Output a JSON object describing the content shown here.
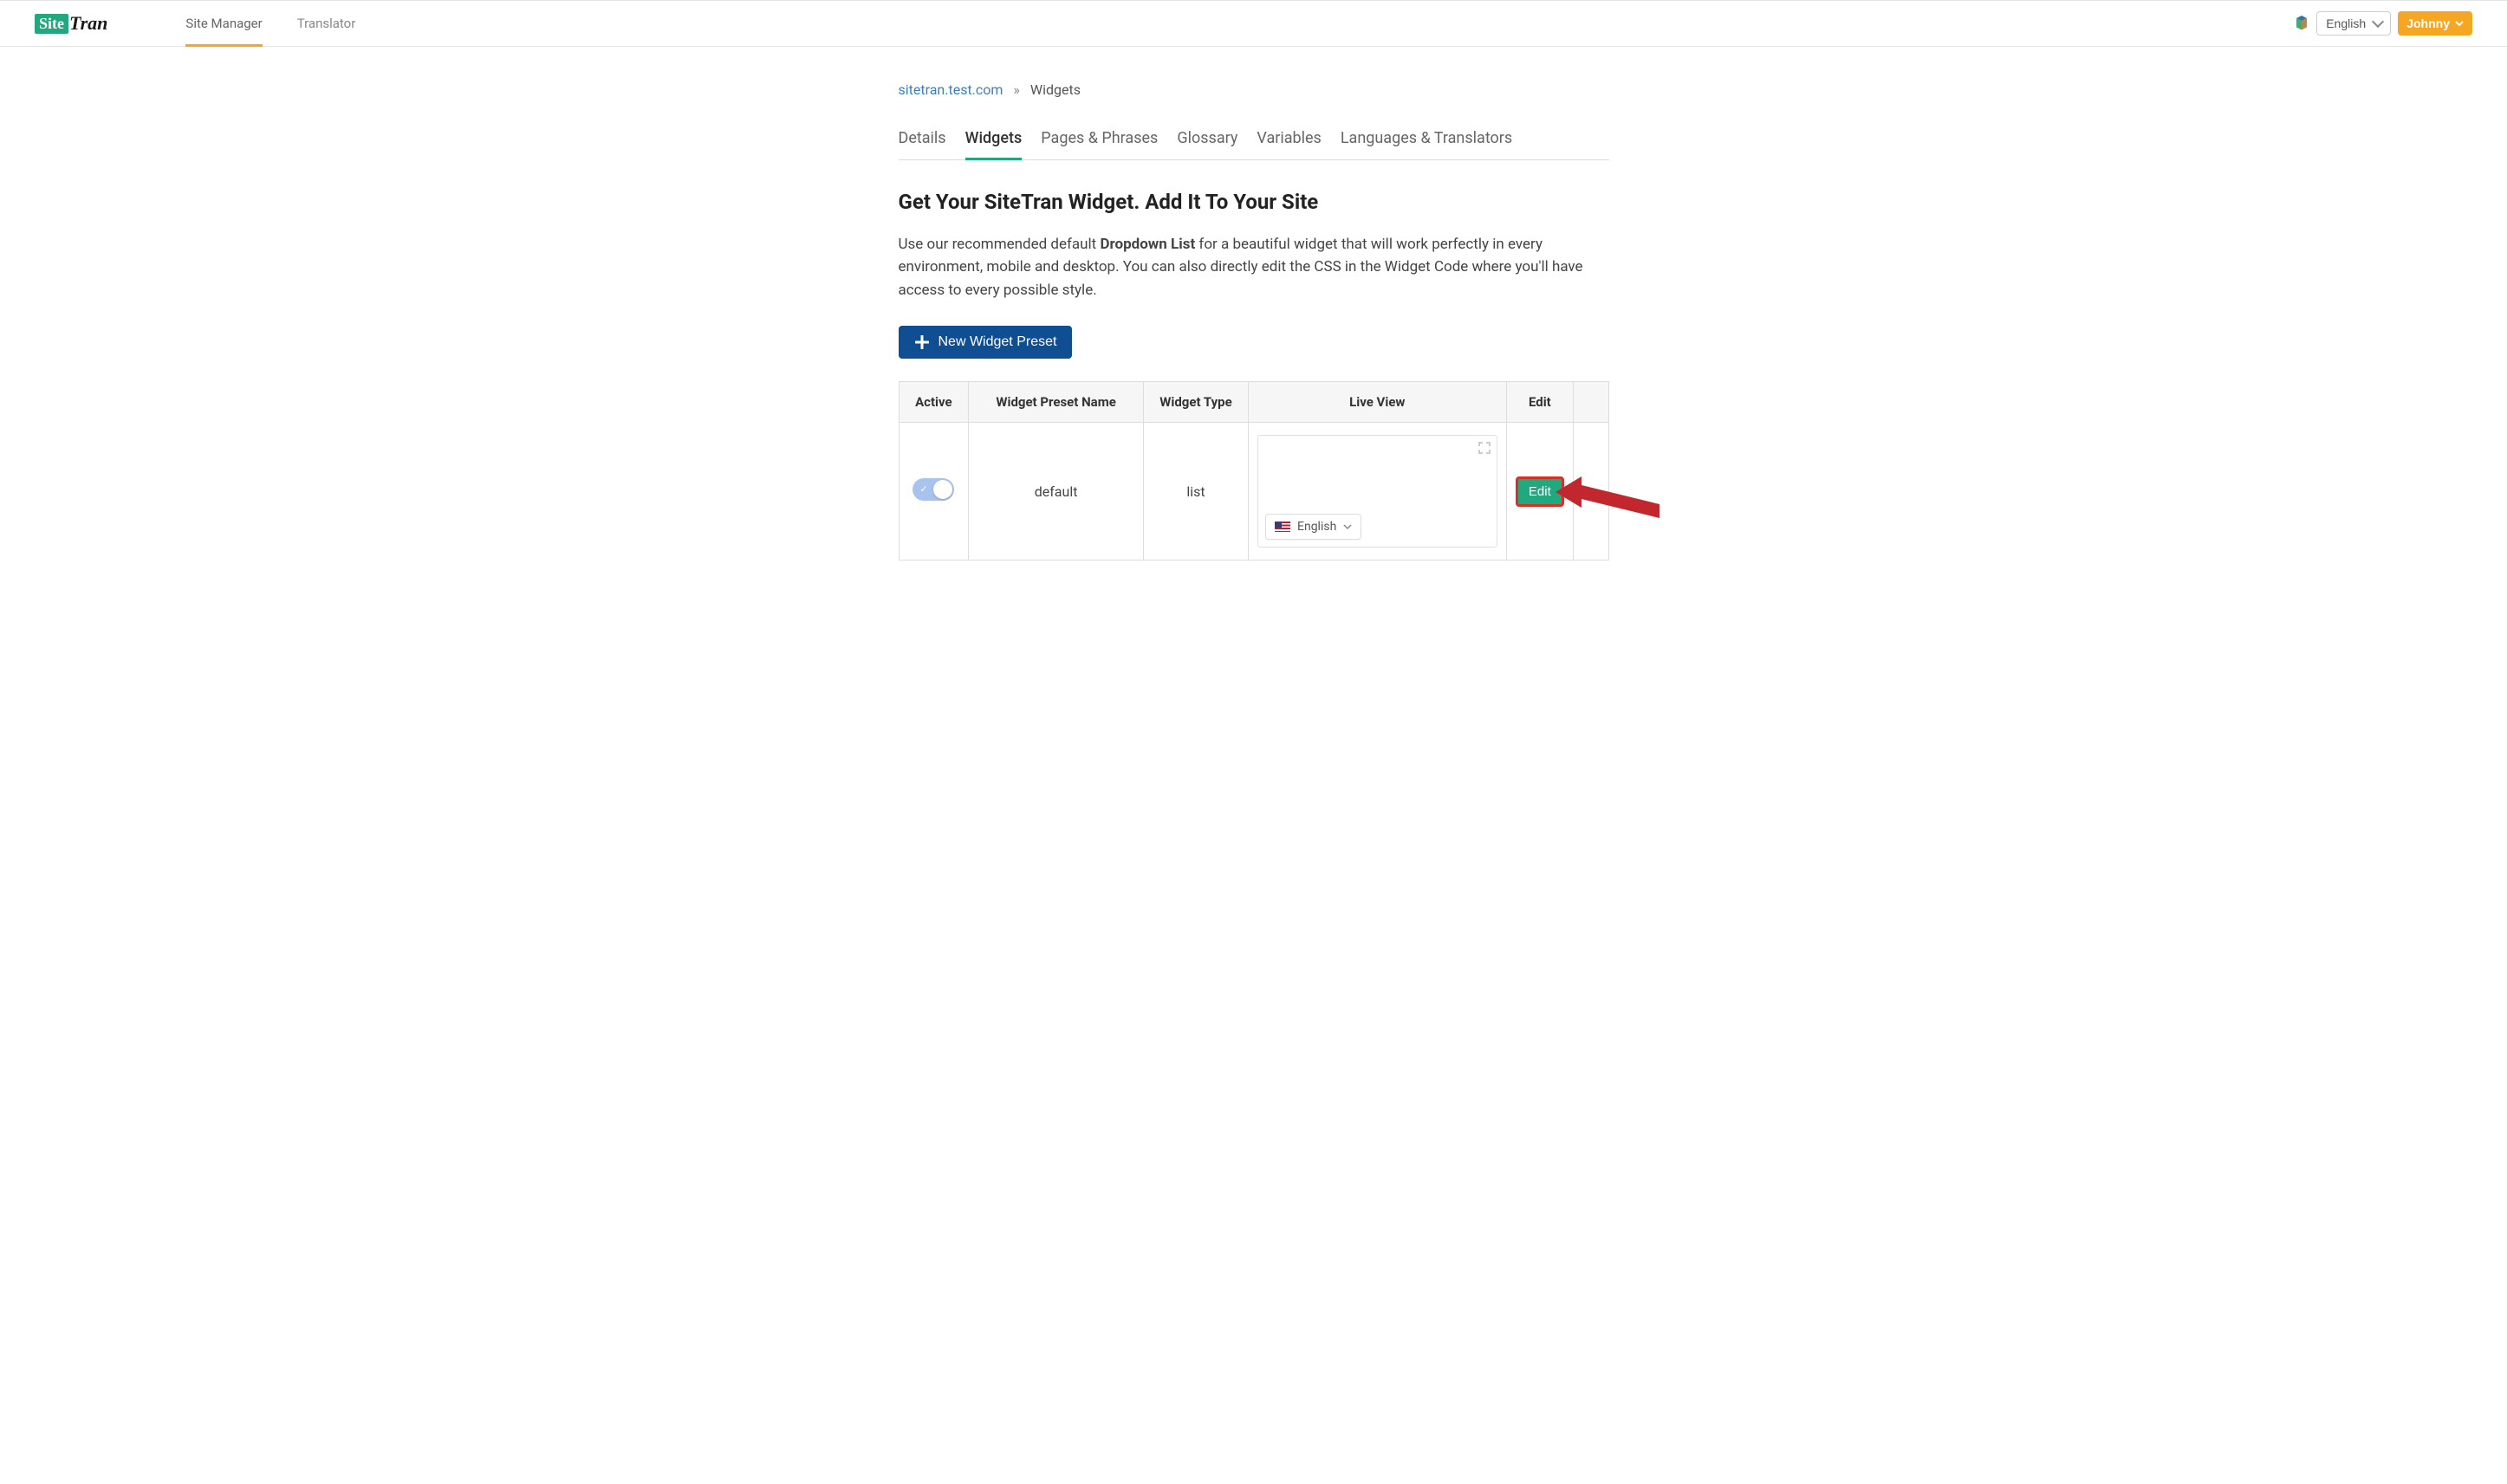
{
  "topnav": {
    "logo_box": "Site",
    "logo_rest": "Tran",
    "links": [
      {
        "label": "Site Manager",
        "active": true
      },
      {
        "label": "Translator",
        "active": false
      }
    ],
    "lang_selected": "English",
    "user_name": "Johnny"
  },
  "breadcrumb": {
    "site": "sitetran.test.com",
    "sep": "»",
    "current": "Widgets"
  },
  "subtabs": [
    {
      "label": "Details",
      "active": false
    },
    {
      "label": "Widgets",
      "active": true
    },
    {
      "label": "Pages & Phrases",
      "active": false
    },
    {
      "label": "Glossary",
      "active": false
    },
    {
      "label": "Variables",
      "active": false
    },
    {
      "label": "Languages & Translators",
      "active": false
    }
  ],
  "heading": "Get Your SiteTran Widget. Add It To Your Site",
  "desc_pre": "Use our recommended default ",
  "desc_bold": "Dropdown List",
  "desc_post": " for a beautiful widget that will work perfectly in every environment, mobile and desktop. You can also directly edit the CSS in the Widget Code where you'll have access to every possible style.",
  "new_preset_label": "New Widget Preset",
  "table": {
    "headers": {
      "active": "Active",
      "name": "Widget Preset Name",
      "type": "Widget Type",
      "live": "Live View",
      "edit": "Edit"
    },
    "rows": [
      {
        "active": true,
        "name": "default",
        "type": "list",
        "live_lang": "English",
        "edit_label": "Edit"
      }
    ]
  }
}
